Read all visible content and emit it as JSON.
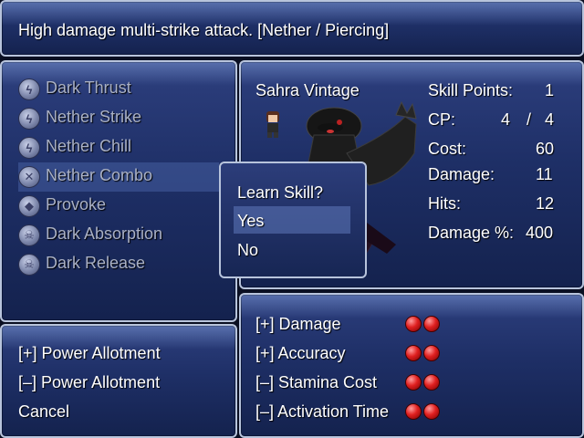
{
  "help": {
    "text": "High damage multi-strike attack. [Nether / Piercing]"
  },
  "skills": [
    {
      "label": "Dark Thrust",
      "icon": "lightning-icon"
    },
    {
      "label": "Nether Strike",
      "icon": "lightning-icon"
    },
    {
      "label": "Nether Chill",
      "icon": "lightning-icon"
    },
    {
      "label": "Nether Combo",
      "icon": "swords-icon",
      "selected": true
    },
    {
      "label": "Provoke",
      "icon": "shield-icon"
    },
    {
      "label": "Dark Absorption",
      "icon": "skull-icon"
    },
    {
      "label": "Dark Release",
      "icon": "skull-icon"
    }
  ],
  "character": {
    "name": "Sahra Vintage"
  },
  "stats": {
    "skill_points_label": "Skill Points:",
    "skill_points_value": "1",
    "cp_label": "CP:",
    "cp_current": "4",
    "cp_sep": "/",
    "cp_max": "4",
    "cost_label": "Cost:",
    "cost_value": "60",
    "damage_label": "Damage:",
    "damage_value": "11",
    "hits_label": "Hits:",
    "hits_value": "12",
    "damage_pct_label": "Damage %:",
    "damage_pct_value": "400"
  },
  "commands": {
    "power_up": "[+] Power Allotment",
    "power_down": "[–] Power Allotment",
    "cancel": "Cancel"
  },
  "upgrades": [
    {
      "label": "[+] Damage",
      "orbs": 2
    },
    {
      "label": "[+] Accuracy",
      "orbs": 2
    },
    {
      "label": "[–] Stamina Cost",
      "orbs": 2
    },
    {
      "label": "[–] Activation Time",
      "orbs": 2
    }
  ],
  "popup": {
    "title": "Learn Skill?",
    "yes": "Yes",
    "no": "No"
  },
  "colors": {
    "orb": "#e02020",
    "panel": "#1e2f66"
  }
}
